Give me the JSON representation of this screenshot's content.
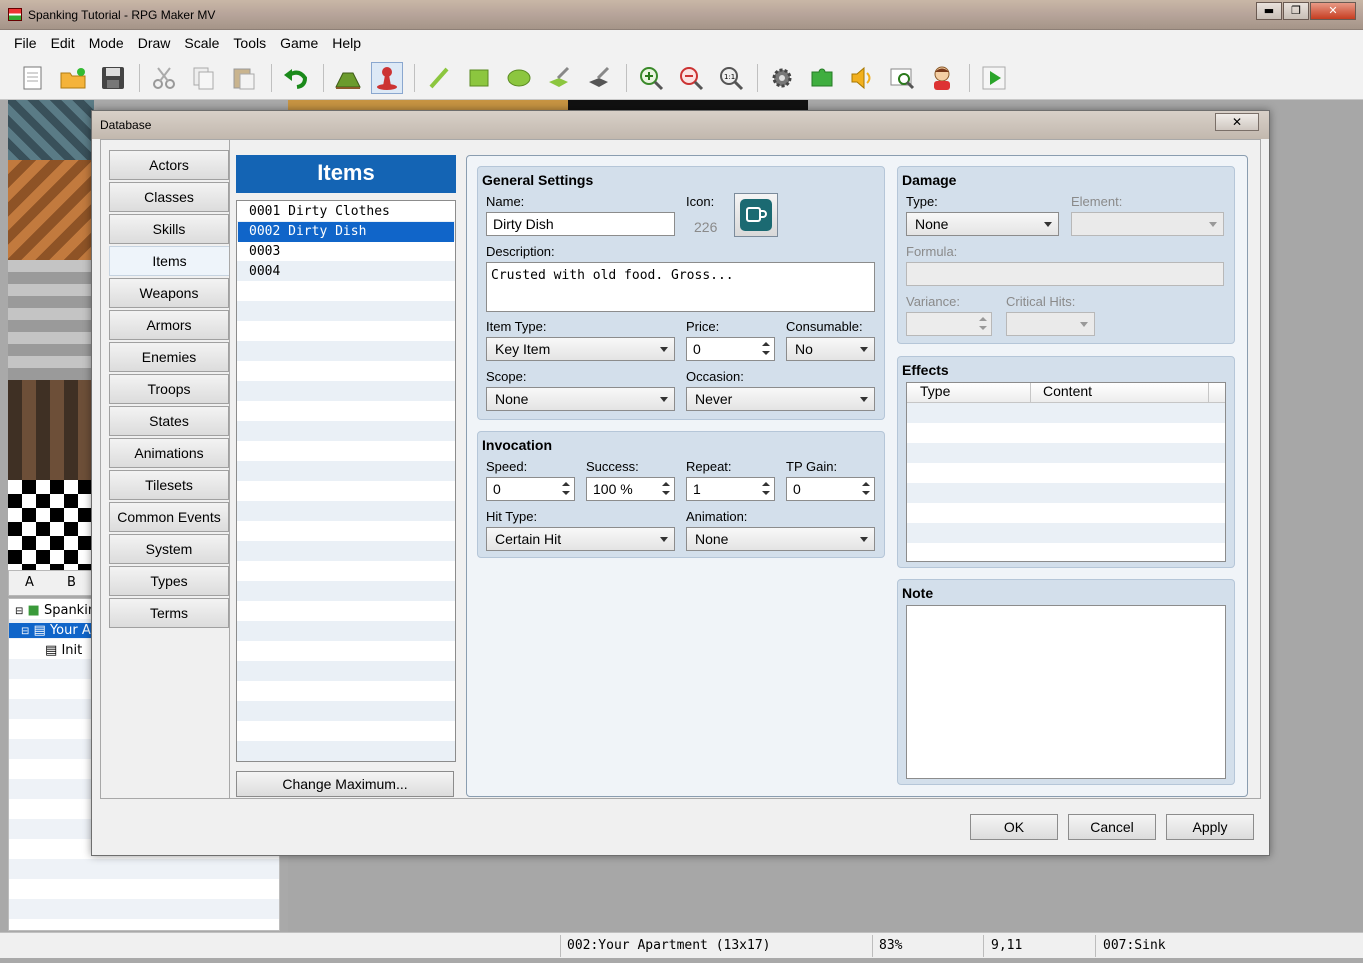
{
  "window": {
    "title": "Spanking Tutorial - RPG Maker MV",
    "min": "▬",
    "max": "❐",
    "close": "✕"
  },
  "menu": [
    "File",
    "Edit",
    "Mode",
    "Draw",
    "Scale",
    "Tools",
    "Game",
    "Help"
  ],
  "toolbar": {
    "icons": [
      "new-project-icon",
      "open-project-icon",
      "save-project-icon",
      "cut-icon",
      "copy-icon",
      "paste-icon",
      "undo-icon",
      "map-mode-icon",
      "event-mode-icon",
      "pencil-icon",
      "rectangle-icon",
      "ellipse-icon",
      "fill-icon",
      "shadow-pen-icon",
      "zoom-in-icon",
      "zoom-out-icon",
      "actual-size-icon",
      "database-icon",
      "plugin-manager-icon",
      "sound-test-icon",
      "event-searcher-icon",
      "character-generator-icon",
      "playtest-icon"
    ]
  },
  "tileset_tabs": {
    "a": "A",
    "b": "B"
  },
  "map_tree": {
    "root": "Spankin",
    "map": "Your A",
    "child": "Init"
  },
  "status": {
    "map": "002:Your Apartment (13x17)",
    "zoom": "83%",
    "coords": "9,11",
    "event": "007:Sink"
  },
  "dialog": {
    "title": "Database",
    "close": "✕",
    "nav": [
      "Actors",
      "Classes",
      "Skills",
      "Items",
      "Weapons",
      "Armors",
      "Enemies",
      "Troops",
      "States",
      "Animations",
      "Tilesets",
      "Common Events",
      "System",
      "Types",
      "Terms"
    ],
    "nav_selected": "Items",
    "list_title": "Items",
    "list": [
      "0001 Dirty Clothes",
      "0002 Dirty Dish",
      "0003",
      "0004"
    ],
    "change_max": "Change Maximum...",
    "general": {
      "title": "General Settings",
      "name_label": "Name:",
      "name": "Dirty Dish",
      "icon_label": "Icon:",
      "icon_index": "226",
      "desc_label": "Description:",
      "desc": "Crusted with old food. Gross...",
      "itemtype_label": "Item Type:",
      "itemtype": "Key Item",
      "price_label": "Price:",
      "price": "0",
      "consumable_label": "Consumable:",
      "consumable": "No",
      "scope_label": "Scope:",
      "scope": "None",
      "occasion_label": "Occasion:",
      "occasion": "Never"
    },
    "invocation": {
      "title": "Invocation",
      "speed_label": "Speed:",
      "speed": "0",
      "success_label": "Success:",
      "success": "100 %",
      "repeat_label": "Repeat:",
      "repeat": "1",
      "tpgain_label": "TP Gain:",
      "tpgain": "0",
      "hittype_label": "Hit Type:",
      "hittype": "Certain Hit",
      "animation_label": "Animation:",
      "animation": "None"
    },
    "damage": {
      "title": "Damage",
      "type_label": "Type:",
      "type": "None",
      "element_label": "Element:",
      "formula_label": "Formula:",
      "variance_label": "Variance:",
      "crit_label": "Critical Hits:"
    },
    "effects": {
      "title": "Effects",
      "col_type": "Type",
      "col_content": "Content"
    },
    "note": {
      "title": "Note"
    },
    "buttons": {
      "ok": "OK",
      "cancel": "Cancel",
      "apply": "Apply"
    }
  }
}
